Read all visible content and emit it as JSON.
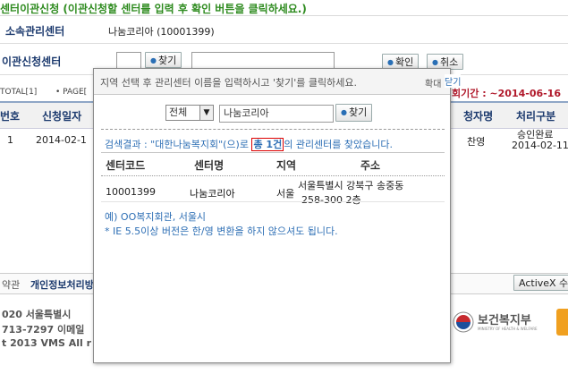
{
  "page": {
    "title": "센터이관신청 (이관신청할 센터를 입력 후 확인 버튼을 클릭하세요.)",
    "form": {
      "center_label": "소속관리센터",
      "center_value": "나눔코리아 (10001399)",
      "transfer_label": "이관신청센터",
      "find_btn": "찾기",
      "confirm_btn": "확인",
      "cancel_btn": "취소"
    },
    "list_info": {
      "total": "TOTAL[1]",
      "page": "• PAGE[",
      "period_label": "회기간 : ~2014-06-16"
    },
    "table": {
      "headers": [
        "번호",
        "신청일자",
        "청자명",
        "처리구분"
      ],
      "row": {
        "num": "1",
        "date": "2014-02-1",
        "name": "찬영",
        "status": "승인완료",
        "status_date": "2014-02-11"
      }
    },
    "footer": {
      "link1": "약관",
      "link2": "개인정보처리방",
      "activex": "ActiveX 수동",
      "line1": "020  서울특별시",
      "line2": "713-7297  이메일",
      "line3": "t 2013 VMS All r",
      "ministry": "보건복지부",
      "ministry_sub": "MINISTRY OF HEALTH & WELFARE"
    }
  },
  "popup": {
    "instruction": "지역 선택 후 관리센터 이름을 입력하시고 '찾기'를 클릭하세요.",
    "enlarge": "확대",
    "close": "닫기",
    "region_select": "전체",
    "search_value": "나눔코리아",
    "find_btn": "찾기",
    "result_prefix": "검색결과 : \"대한나눔복지회\"(으)로",
    "result_count": "총 1건",
    "result_suffix": "의 관리센터를 찾았습니다.",
    "columns": [
      "센터코드",
      "센터명",
      "지역",
      "주소"
    ],
    "rows": [
      {
        "code": "10001399",
        "name": "나눔코리아",
        "region": "서울",
        "address1": "서울특별시 강북구 송중동",
        "address2": "258-300 2층"
      }
    ],
    "example": "예) OO복지회관, 서울시",
    "ie_note": "* IE 5.5이상 버전은 한/영 변환을 하지 않으셔도 됩니다."
  },
  "colors": {
    "title_green": "#2e8b1f",
    "label_navy": "#1c3a6e",
    "link_blue": "#2e6fb5",
    "highlight_red": "#dd0000",
    "period_red": "#b0182a"
  }
}
